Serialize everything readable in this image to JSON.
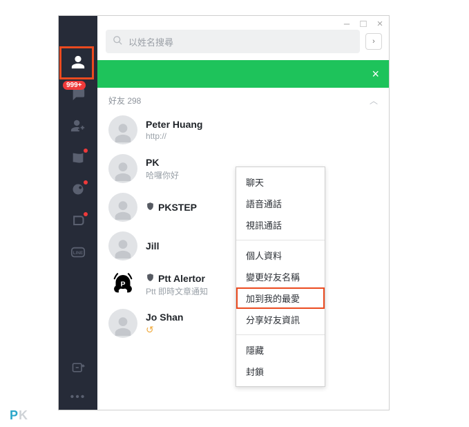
{
  "window": {
    "minimize": "–",
    "maximize": "□",
    "close": "×"
  },
  "search": {
    "placeholder": "以姓名搜尋"
  },
  "sidebar": {
    "chat_badge": "999+"
  },
  "section": {
    "label": "好友 298"
  },
  "friends": [
    {
      "name": "Peter Huang",
      "sub": "http://",
      "shield": false,
      "presence": true
    },
    {
      "name": "PK",
      "sub": "哈囉你好",
      "shield": false,
      "presence": true
    },
    {
      "name": "PKSTEP",
      "sub": "",
      "shield": true,
      "presence": false
    },
    {
      "name": "Jill",
      "sub": "",
      "shield": false,
      "presence": true
    },
    {
      "name": "Ptt Alertor",
      "sub": "Ptt 即時文章通知",
      "shield": true,
      "presence": false,
      "custom": "ptt"
    },
    {
      "name": "Jo Shan",
      "sub": "↺",
      "shield": false,
      "presence": true
    }
  ],
  "context_menu": {
    "group1": [
      "聊天",
      "語音通話",
      "視訊通話"
    ],
    "group2": [
      "個人資料",
      "變更好友名稱",
      "加到我的最愛",
      "分享好友資訊"
    ],
    "group3": [
      "隱藏",
      "封鎖"
    ],
    "highlight": "加到我的最愛"
  },
  "watermark": {
    "p": "P",
    "k": "K"
  },
  "colors": {
    "accent_orange": "#eb4a1f",
    "accent_green": "#1ec35b"
  }
}
